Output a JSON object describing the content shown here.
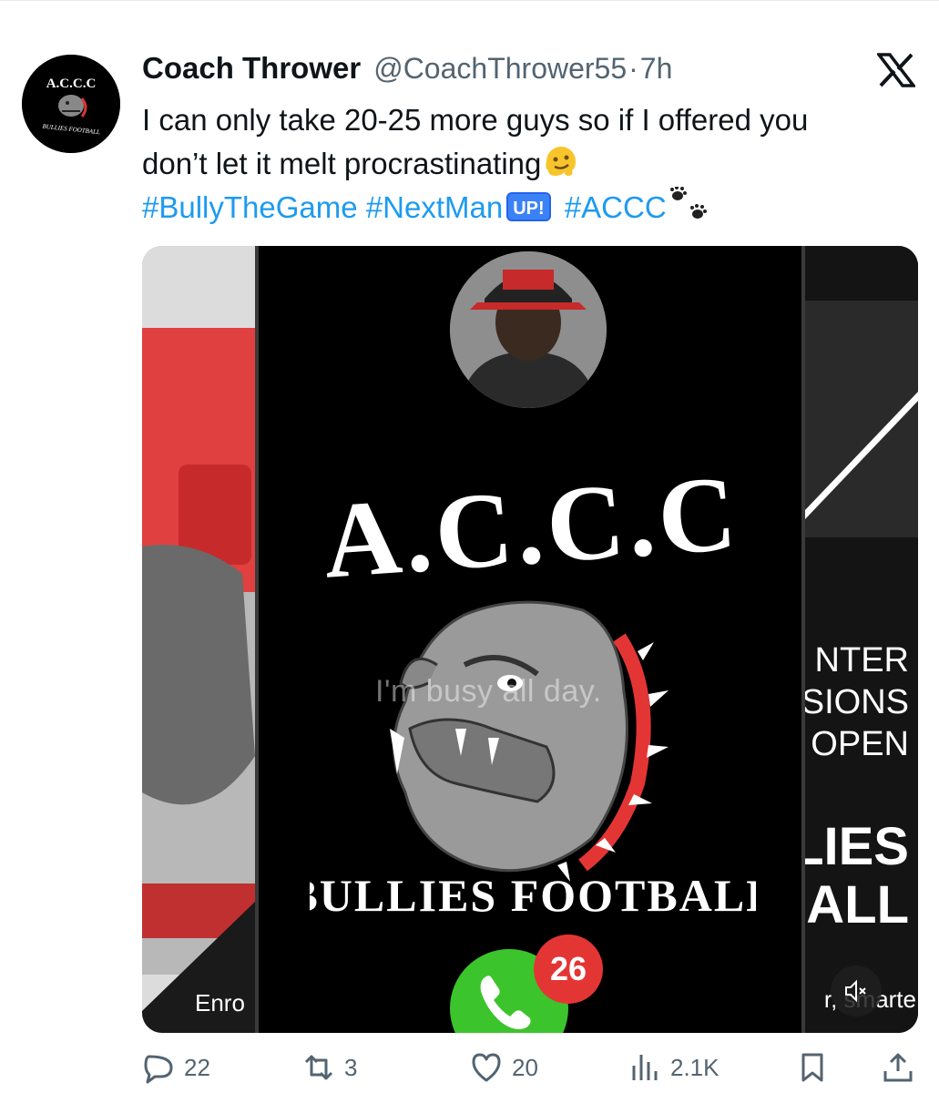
{
  "tweet": {
    "display_name": "Coach Thrower",
    "handle": "@CoachThrower55",
    "separator": "·",
    "time": "7h",
    "text_line1": "I can only take 20-25 more guys so if I offered you",
    "text_line2": "don’t let it melt procrastinating",
    "hashtags": [
      "#BullyTheGame",
      "#NextMan",
      "#ACCC"
    ],
    "up_badge": "UP!",
    "platform_icon": "x-logo-icon"
  },
  "avatar_logo": {
    "title": "A.C.C.C",
    "subtitle": "BULLIES FOOTBALL"
  },
  "media": {
    "center_logo_title": "A.C.C.C",
    "center_logo_subtitle": "BULLIES FOOTBALL",
    "overlay_caption": "I'm busy all day.",
    "call_badge_count": "26",
    "right_panel_lines": [
      "NTER",
      "SIONS",
      "OPEN"
    ],
    "right_panel_big": [
      "LIES",
      "ALL"
    ],
    "right_panel_footer": "r, smarte",
    "left_panel_footer": "Enro",
    "colors": {
      "accent_red": "#e43535",
      "call_green": "#3cc42c",
      "link_blue": "#1d9bf0"
    }
  },
  "actions": {
    "replies": "22",
    "retweets": "3",
    "likes": "20",
    "views": "2.1K"
  }
}
